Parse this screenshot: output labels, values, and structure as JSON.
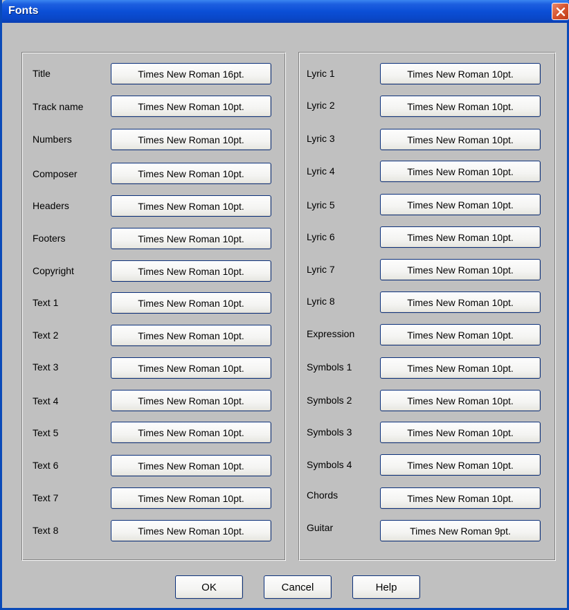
{
  "window": {
    "title": "Fonts"
  },
  "left_rows": [
    {
      "label": "Title",
      "font": "Times New Roman 16pt."
    },
    {
      "label": "Track name",
      "font": "Times New Roman 10pt."
    },
    {
      "label": "Numbers",
      "font": "Times New Roman 10pt."
    },
    {
      "label": "Composer",
      "font": "Times New Roman 10pt."
    },
    {
      "label": "Headers",
      "font": "Times New Roman 10pt."
    },
    {
      "label": "Footers",
      "font": "Times New Roman 10pt."
    },
    {
      "label": "Copyright",
      "font": "Times New Roman 10pt."
    },
    {
      "label": "Text 1",
      "font": "Times New Roman 10pt."
    },
    {
      "label": "Text 2",
      "font": "Times New Roman 10pt."
    },
    {
      "label": "Text 3",
      "font": "Times New Roman 10pt."
    },
    {
      "label": "Text 4",
      "font": "Times New Roman 10pt."
    },
    {
      "label": "Text 5",
      "font": "Times New Roman 10pt."
    },
    {
      "label": "Text 6",
      "font": "Times New Roman 10pt."
    },
    {
      "label": "Text 7",
      "font": "Times New Roman 10pt."
    },
    {
      "label": "Text 8",
      "font": "Times New Roman 10pt."
    }
  ],
  "right_rows": [
    {
      "label": "Lyric 1",
      "font": "Times New Roman 10pt."
    },
    {
      "label": "Lyric 2",
      "font": "Times New Roman 10pt."
    },
    {
      "label": "Lyric 3",
      "font": "Times New Roman 10pt."
    },
    {
      "label": "Lyric 4",
      "font": "Times New Roman 10pt."
    },
    {
      "label": "Lyric 5",
      "font": "Times New Roman 10pt."
    },
    {
      "label": "Lyric 6",
      "font": "Times New Roman 10pt."
    },
    {
      "label": "Lyric 7",
      "font": "Times New Roman 10pt."
    },
    {
      "label": "Lyric 8",
      "font": "Times New Roman 10pt."
    },
    {
      "label": "Expression",
      "font": "Times New Roman 10pt."
    },
    {
      "label": "Symbols 1",
      "font": "Times New Roman 10pt."
    },
    {
      "label": "Symbols 2",
      "font": "Times New Roman 10pt."
    },
    {
      "label": "Symbols 3",
      "font": "Times New Roman 10pt."
    },
    {
      "label": "Symbols 4",
      "font": "Times New Roman 10pt."
    },
    {
      "label": "Chords",
      "font": "Times New Roman 10pt."
    },
    {
      "label": "Guitar",
      "font": "Times New Roman 9pt."
    }
  ],
  "buttons": {
    "ok": "OK",
    "cancel": "Cancel",
    "help": "Help"
  },
  "icons": {
    "close": "close-icon"
  },
  "colors": {
    "titlebar": "#0a47c8",
    "close": "#d6542f",
    "dialog_bg": "#c0c0c0"
  }
}
